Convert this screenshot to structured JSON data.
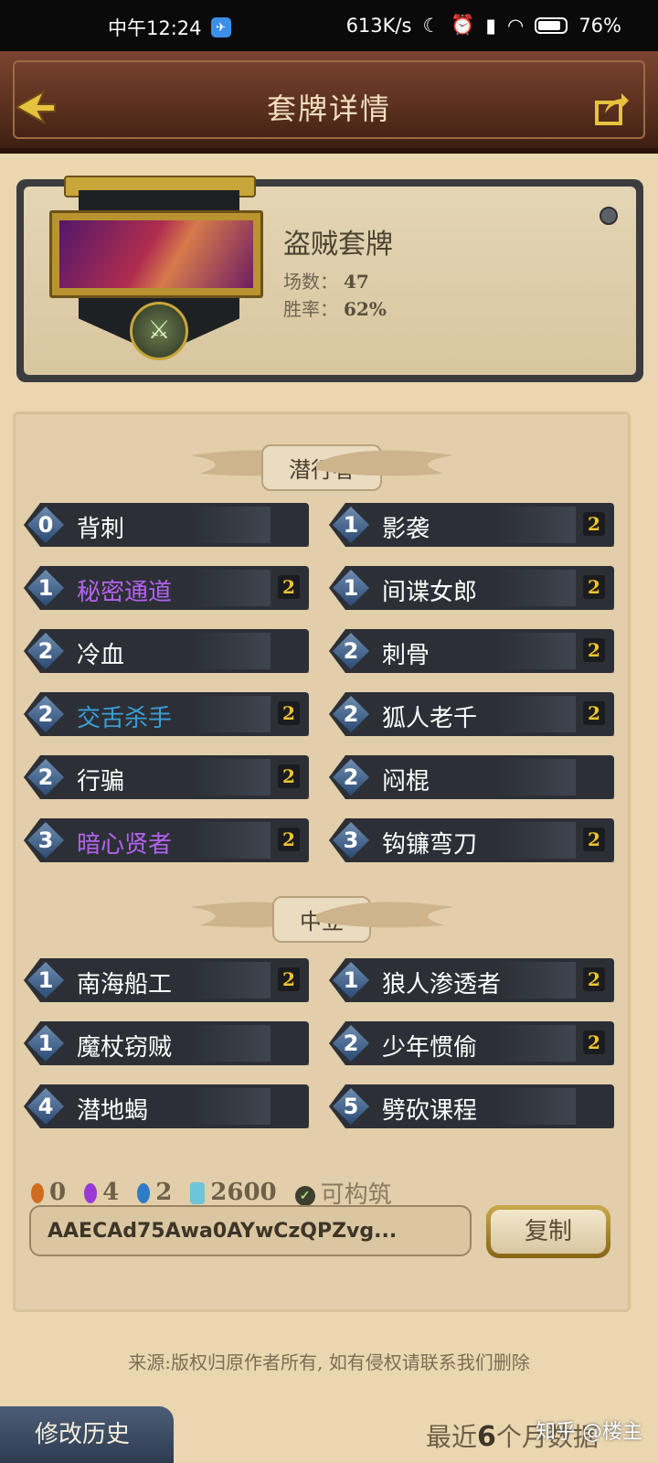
{
  "status_bar": {
    "time": "中午12:24",
    "net_speed": "613K/s",
    "icons": [
      "moon-icon",
      "alarm-icon",
      "signal-icon",
      "wifi-icon"
    ],
    "battery": "76%"
  },
  "header": {
    "title": "套牌详情",
    "back_icon": "back-arrow-icon",
    "share_icon": "share-icon"
  },
  "deck": {
    "name": "盗贼套牌",
    "games_label": "场数：",
    "games_value": "47",
    "winrate_label": "胜率：",
    "winrate_value": "62%",
    "class_icon": "daggers-icon",
    "colors": {
      "frame_gold": "#c8a63a",
      "panel_dark": "#3a3c3e"
    }
  },
  "sections": [
    {
      "label": "潜行者",
      "cards": [
        {
          "cost": "0",
          "name": "背刺",
          "count": "",
          "rarity": "common"
        },
        {
          "cost": "1",
          "name": "影袭",
          "count": "2",
          "rarity": "common"
        },
        {
          "cost": "1",
          "name": "秘密通道",
          "count": "2",
          "rarity": "epic"
        },
        {
          "cost": "1",
          "name": "间谍女郎",
          "count": "2",
          "rarity": "common"
        },
        {
          "cost": "2",
          "name": "冷血",
          "count": "",
          "rarity": "common"
        },
        {
          "cost": "2",
          "name": "刺骨",
          "count": "2",
          "rarity": "common"
        },
        {
          "cost": "2",
          "name": "交舌杀手",
          "count": "2",
          "rarity": "rare"
        },
        {
          "cost": "2",
          "name": "狐人老千",
          "count": "2",
          "rarity": "common"
        },
        {
          "cost": "2",
          "name": "行骗",
          "count": "2",
          "rarity": "common"
        },
        {
          "cost": "2",
          "name": "闷棍",
          "count": "",
          "rarity": "common"
        },
        {
          "cost": "3",
          "name": "暗心贤者",
          "count": "2",
          "rarity": "epic"
        },
        {
          "cost": "3",
          "name": "钩镰弯刀",
          "count": "2",
          "rarity": "common"
        }
      ]
    },
    {
      "label": "中立",
      "cards": [
        {
          "cost": "1",
          "name": "南海船工",
          "count": "2",
          "rarity": "common"
        },
        {
          "cost": "1",
          "name": "狼人渗透者",
          "count": "2",
          "rarity": "common"
        },
        {
          "cost": "1",
          "name": "魔杖窃贼",
          "count": "",
          "rarity": "common"
        },
        {
          "cost": "2",
          "name": "少年惯偷",
          "count": "2",
          "rarity": "common"
        },
        {
          "cost": "4",
          "name": "潜地蝎",
          "count": "",
          "rarity": "common"
        },
        {
          "cost": "5",
          "name": "劈砍课程",
          "count": "",
          "rarity": "common"
        }
      ]
    }
  ],
  "rarity_colors": {
    "common": "#ffffff",
    "rare": "#3b9ed8",
    "epic": "#b462f0"
  },
  "summary": {
    "legendary_count": "0",
    "epic_count": "4",
    "rare_count": "2",
    "dust": "2600",
    "buildable_label": "可构筑"
  },
  "deck_code": {
    "value": "AAECAd75Awa0AYwCzQPZvg...",
    "copy_label": "复制"
  },
  "footer": {
    "source_note": "来源:版权归原作者所有, 如有侵权请联系我们删除",
    "history_label": "修改历史",
    "recent_prefix": "最近",
    "recent_count": "6",
    "recent_suffix": "个月数据",
    "watermark": "知乎 @楼主"
  }
}
